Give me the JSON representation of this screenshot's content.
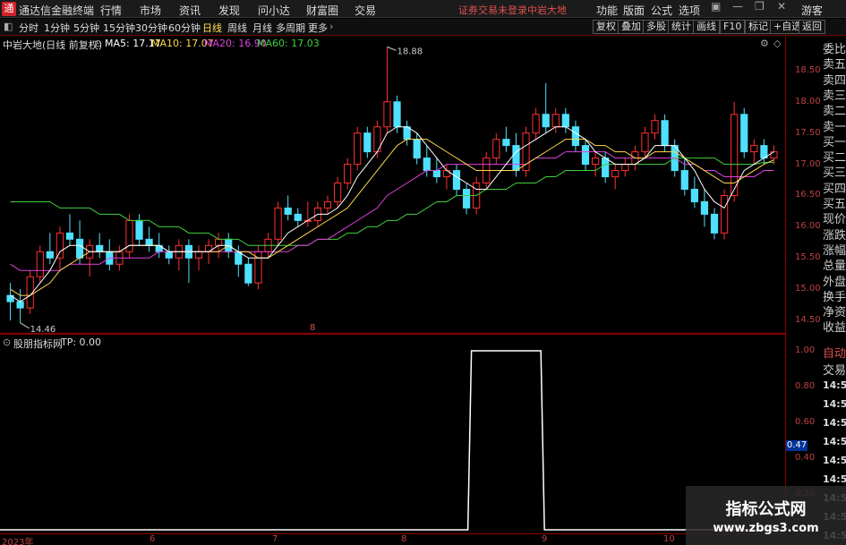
{
  "app": {
    "title": "通达信金融终端",
    "menu": [
      "行情",
      "市场",
      "资讯",
      "发现",
      "问小达",
      "财富圈",
      "交易"
    ],
    "account_status": "证券交易未登录",
    "stock_title": "中岩大地",
    "right_menu": [
      "功能",
      "版面",
      "公式",
      "选项"
    ],
    "guest_label": "游客"
  },
  "toolbar": {
    "periods": [
      "分时",
      "1分钟",
      "5分钟",
      "15分钟",
      "30分钟",
      "60分钟",
      "日线",
      "周线",
      "月线",
      "多周期",
      "更多"
    ],
    "active_period": "日线",
    "buttons": [
      "复权",
      "叠加",
      "多股",
      "统计",
      "画线",
      "F10",
      "标记",
      "+自选",
      "返回"
    ]
  },
  "main_chart": {
    "stock_label": "中岩大地(日线 前复权)",
    "ma_legends": [
      {
        "text": "MA5: 17.17",
        "color": "#ffffff"
      },
      {
        "text": "MA10: 17.07",
        "color": "#ffd84a"
      },
      {
        "text": "MA20: 16.90",
        "color": "#e040e0"
      },
      {
        "text": "MA60: 17.03",
        "color": "#40d040"
      }
    ],
    "high_marker": "18.88",
    "low_marker": "14.46",
    "mid_marker": "8",
    "y_ticks": [
      "18.50",
      "18.00",
      "17.50",
      "17.00",
      "16.50",
      "16.00",
      "15.50",
      "15.00",
      "14.50"
    ],
    "colors": {
      "up": "#ff3030",
      "down": "#4fe0ff",
      "ma5": "#ffffff",
      "ma10": "#ffd84a",
      "ma20": "#e040e0",
      "ma60": "#40d040"
    }
  },
  "chart_data": {
    "type": "candlestick",
    "ylim": [
      14.3,
      19.0
    ],
    "candles": [
      [
        14.9,
        15.1,
        14.5,
        14.8
      ],
      [
        14.8,
        15.0,
        14.46,
        14.7
      ],
      [
        14.7,
        15.3,
        14.6,
        15.2
      ],
      [
        15.2,
        15.7,
        15.1,
        15.6
      ],
      [
        15.6,
        15.9,
        15.4,
        15.5
      ],
      [
        15.5,
        16.0,
        15.3,
        15.9
      ],
      [
        15.9,
        16.2,
        15.7,
        15.8
      ],
      [
        15.8,
        16.1,
        15.4,
        15.5
      ],
      [
        15.5,
        15.8,
        15.2,
        15.7
      ],
      [
        15.7,
        15.9,
        15.5,
        15.6
      ],
      [
        15.6,
        15.8,
        15.3,
        15.4
      ],
      [
        15.4,
        15.7,
        15.3,
        15.6
      ],
      [
        15.6,
        16.2,
        15.5,
        16.1
      ],
      [
        16.1,
        16.2,
        15.7,
        15.8
      ],
      [
        15.8,
        16.0,
        15.6,
        15.7
      ],
      [
        15.7,
        15.9,
        15.5,
        15.6
      ],
      [
        15.6,
        15.7,
        15.4,
        15.5
      ],
      [
        15.5,
        15.8,
        15.3,
        15.7
      ],
      [
        15.7,
        15.8,
        15.1,
        15.5
      ],
      [
        15.5,
        15.7,
        15.3,
        15.6
      ],
      [
        15.6,
        15.8,
        15.4,
        15.7
      ],
      [
        15.7,
        15.9,
        15.5,
        15.8
      ],
      [
        15.8,
        15.9,
        15.5,
        15.6
      ],
      [
        15.6,
        15.7,
        15.2,
        15.4
      ],
      [
        15.4,
        15.5,
        15.05,
        15.1
      ],
      [
        15.1,
        15.7,
        15.0,
        15.6
      ],
      [
        15.6,
        15.9,
        15.5,
        15.8
      ],
      [
        15.8,
        16.4,
        15.7,
        16.3
      ],
      [
        16.3,
        16.5,
        16.1,
        16.2
      ],
      [
        16.2,
        16.3,
        16.0,
        16.1
      ],
      [
        16.1,
        16.4,
        16.0,
        16.1
      ],
      [
        16.1,
        16.4,
        16.0,
        16.3
      ],
      [
        16.3,
        16.5,
        16.2,
        16.4
      ],
      [
        16.4,
        16.8,
        16.3,
        16.7
      ],
      [
        16.7,
        17.1,
        16.6,
        17.0
      ],
      [
        17.0,
        17.6,
        16.9,
        17.5
      ],
      [
        17.5,
        17.6,
        17.1,
        17.2
      ],
      [
        17.2,
        17.7,
        17.1,
        17.6
      ],
      [
        17.6,
        18.88,
        17.5,
        18.0
      ],
      [
        18.0,
        18.1,
        17.5,
        17.6
      ],
      [
        17.6,
        17.7,
        17.3,
        17.4
      ],
      [
        17.4,
        17.5,
        17.0,
        17.1
      ],
      [
        17.1,
        17.3,
        16.8,
        16.9
      ],
      [
        16.9,
        17.1,
        16.7,
        16.8
      ],
      [
        16.8,
        17.0,
        16.6,
        16.9
      ],
      [
        16.9,
        17.0,
        16.5,
        16.6
      ],
      [
        16.6,
        16.7,
        16.2,
        16.3
      ],
      [
        16.3,
        16.8,
        16.2,
        16.7
      ],
      [
        16.7,
        17.2,
        16.6,
        17.1
      ],
      [
        17.1,
        17.5,
        17.0,
        17.4
      ],
      [
        17.4,
        17.6,
        17.2,
        17.3
      ],
      [
        17.3,
        17.5,
        16.8,
        16.9
      ],
      [
        16.9,
        17.6,
        16.8,
        17.5
      ],
      [
        17.5,
        17.9,
        17.4,
        17.8
      ],
      [
        17.8,
        18.3,
        17.5,
        17.6
      ],
      [
        17.6,
        17.9,
        17.5,
        17.8
      ],
      [
        17.8,
        17.9,
        17.5,
        17.6
      ],
      [
        17.6,
        17.7,
        17.2,
        17.3
      ],
      [
        17.3,
        17.4,
        16.9,
        17.0
      ],
      [
        17.0,
        17.2,
        16.8,
        17.1
      ],
      [
        17.1,
        17.2,
        16.7,
        16.8
      ],
      [
        16.8,
        17.0,
        16.6,
        16.9
      ],
      [
        16.9,
        17.1,
        16.8,
        17.0
      ],
      [
        17.0,
        17.3,
        16.9,
        17.2
      ],
      [
        17.2,
        17.6,
        17.1,
        17.5
      ],
      [
        17.5,
        17.8,
        17.4,
        17.7
      ],
      [
        17.7,
        17.8,
        17.2,
        17.3
      ],
      [
        17.3,
        17.4,
        16.8,
        16.9
      ],
      [
        16.9,
        17.1,
        16.5,
        16.6
      ],
      [
        16.6,
        16.8,
        16.3,
        16.4
      ],
      [
        16.4,
        16.6,
        16.0,
        16.2
      ],
      [
        16.2,
        16.3,
        15.8,
        15.9
      ],
      [
        15.9,
        16.6,
        15.8,
        16.5
      ],
      [
        16.5,
        18.0,
        16.4,
        17.8
      ],
      [
        17.8,
        17.9,
        17.1,
        17.2
      ],
      [
        17.2,
        17.4,
        17.0,
        17.3
      ],
      [
        17.3,
        17.4,
        17.0,
        17.1
      ],
      [
        17.1,
        17.3,
        17.0,
        17.2
      ]
    ],
    "ma5": [
      14.9,
      14.8,
      14.9,
      15.1,
      15.3,
      15.6,
      15.7,
      15.7,
      15.6,
      15.6,
      15.6,
      15.6,
      15.7,
      15.7,
      15.7,
      15.7,
      15.6,
      15.6,
      15.6,
      15.6,
      15.6,
      15.7,
      15.7,
      15.6,
      15.5,
      15.5,
      15.5,
      15.7,
      15.9,
      16.0,
      16.1,
      16.2,
      16.2,
      16.3,
      16.5,
      16.8,
      17.0,
      17.2,
      17.5,
      17.6,
      17.6,
      17.5,
      17.3,
      17.1,
      16.9,
      16.8,
      16.7,
      16.6,
      16.6,
      16.8,
      17.0,
      17.2,
      17.3,
      17.4,
      17.5,
      17.6,
      17.6,
      17.5,
      17.4,
      17.2,
      17.1,
      17.0,
      17.0,
      17.0,
      17.1,
      17.3,
      17.3,
      17.3,
      17.1,
      16.9,
      16.6,
      16.4,
      16.3,
      16.6,
      16.9,
      17.0,
      17.1,
      17.2
    ],
    "ma10": [
      15.0,
      14.9,
      14.9,
      15.0,
      15.1,
      15.3,
      15.4,
      15.5,
      15.6,
      15.6,
      15.6,
      15.6,
      15.7,
      15.7,
      15.7,
      15.7,
      15.6,
      15.6,
      15.6,
      15.6,
      15.6,
      15.6,
      15.7,
      15.6,
      15.6,
      15.5,
      15.5,
      15.6,
      15.7,
      15.8,
      15.9,
      16.0,
      16.1,
      16.2,
      16.3,
      16.5,
      16.7,
      16.9,
      17.1,
      17.3,
      17.4,
      17.4,
      17.4,
      17.3,
      17.2,
      17.1,
      17.0,
      16.9,
      16.9,
      16.9,
      16.9,
      16.9,
      17.0,
      17.1,
      17.2,
      17.3,
      17.4,
      17.4,
      17.4,
      17.3,
      17.3,
      17.2,
      17.2,
      17.1,
      17.1,
      17.2,
      17.2,
      17.2,
      17.1,
      17.0,
      16.9,
      16.8,
      16.7,
      16.7,
      16.8,
      16.9,
      17.0,
      17.07
    ],
    "ma20": [
      15.4,
      15.3,
      15.3,
      15.3,
      15.3,
      15.3,
      15.4,
      15.4,
      15.4,
      15.4,
      15.5,
      15.5,
      15.5,
      15.5,
      15.5,
      15.6,
      15.6,
      15.6,
      15.6,
      15.6,
      15.6,
      15.6,
      15.6,
      15.6,
      15.6,
      15.6,
      15.6,
      15.6,
      15.6,
      15.7,
      15.7,
      15.8,
      15.8,
      15.9,
      16.0,
      16.1,
      16.2,
      16.3,
      16.5,
      16.6,
      16.7,
      16.8,
      16.9,
      16.9,
      17.0,
      17.0,
      17.0,
      17.0,
      17.0,
      17.0,
      17.0,
      17.0,
      17.0,
      17.1,
      17.1,
      17.1,
      17.2,
      17.2,
      17.2,
      17.2,
      17.2,
      17.1,
      17.1,
      17.1,
      17.1,
      17.1,
      17.1,
      17.1,
      17.0,
      17.0,
      16.9,
      16.9,
      16.8,
      16.8,
      16.8,
      16.8,
      16.9,
      16.9
    ],
    "ma60": [
      16.4,
      16.4,
      16.4,
      16.4,
      16.4,
      16.3,
      16.3,
      16.3,
      16.3,
      16.2,
      16.2,
      16.2,
      16.1,
      16.1,
      16.1,
      16.0,
      16.0,
      16.0,
      15.9,
      15.9,
      15.9,
      15.8,
      15.8,
      15.8,
      15.7,
      15.7,
      15.7,
      15.7,
      15.7,
      15.7,
      15.7,
      15.8,
      15.8,
      15.8,
      15.9,
      15.9,
      16.0,
      16.0,
      16.1,
      16.1,
      16.2,
      16.2,
      16.3,
      16.4,
      16.4,
      16.5,
      16.5,
      16.5,
      16.6,
      16.6,
      16.6,
      16.7,
      16.7,
      16.7,
      16.8,
      16.8,
      16.9,
      16.9,
      16.9,
      16.9,
      17.0,
      17.0,
      17.0,
      17.0,
      17.0,
      17.0,
      17.0,
      17.1,
      17.1,
      17.1,
      17.1,
      17.1,
      17.0,
      17.0,
      17.0,
      17.0,
      17.03,
      17.03
    ]
  },
  "sub_chart": {
    "label": "股朋指标网",
    "tp_legend": "TP: 0.00",
    "y_ticks": [
      "1.00",
      "0.80",
      "0.60",
      "0.40",
      "0.20"
    ],
    "current_value": "0.47",
    "signal_window": {
      "start_index": 47,
      "end_index": 53
    },
    "tp_values_desc": "0 except 1 between signal window"
  },
  "dates": [
    "2023年",
    "6",
    "7",
    "8",
    "9",
    "10"
  ],
  "quote_panel": {
    "labels": [
      "委比",
      "卖五",
      "卖四",
      "卖三",
      "卖二",
      "卖一",
      "买一",
      "买二",
      "买三",
      "买四",
      "买五",
      "现价",
      "涨跌",
      "涨幅",
      "总量",
      "外盘",
      "换手",
      "净资",
      "收益",
      "自动",
      "交易",
      "14:56",
      "14:56",
      "14:56",
      "14:56",
      "14:56",
      "14:56",
      "14:56",
      "14:56",
      "14:56"
    ]
  },
  "watermark": {
    "title": "指标公式网",
    "url": "www.zbgs3.com"
  }
}
